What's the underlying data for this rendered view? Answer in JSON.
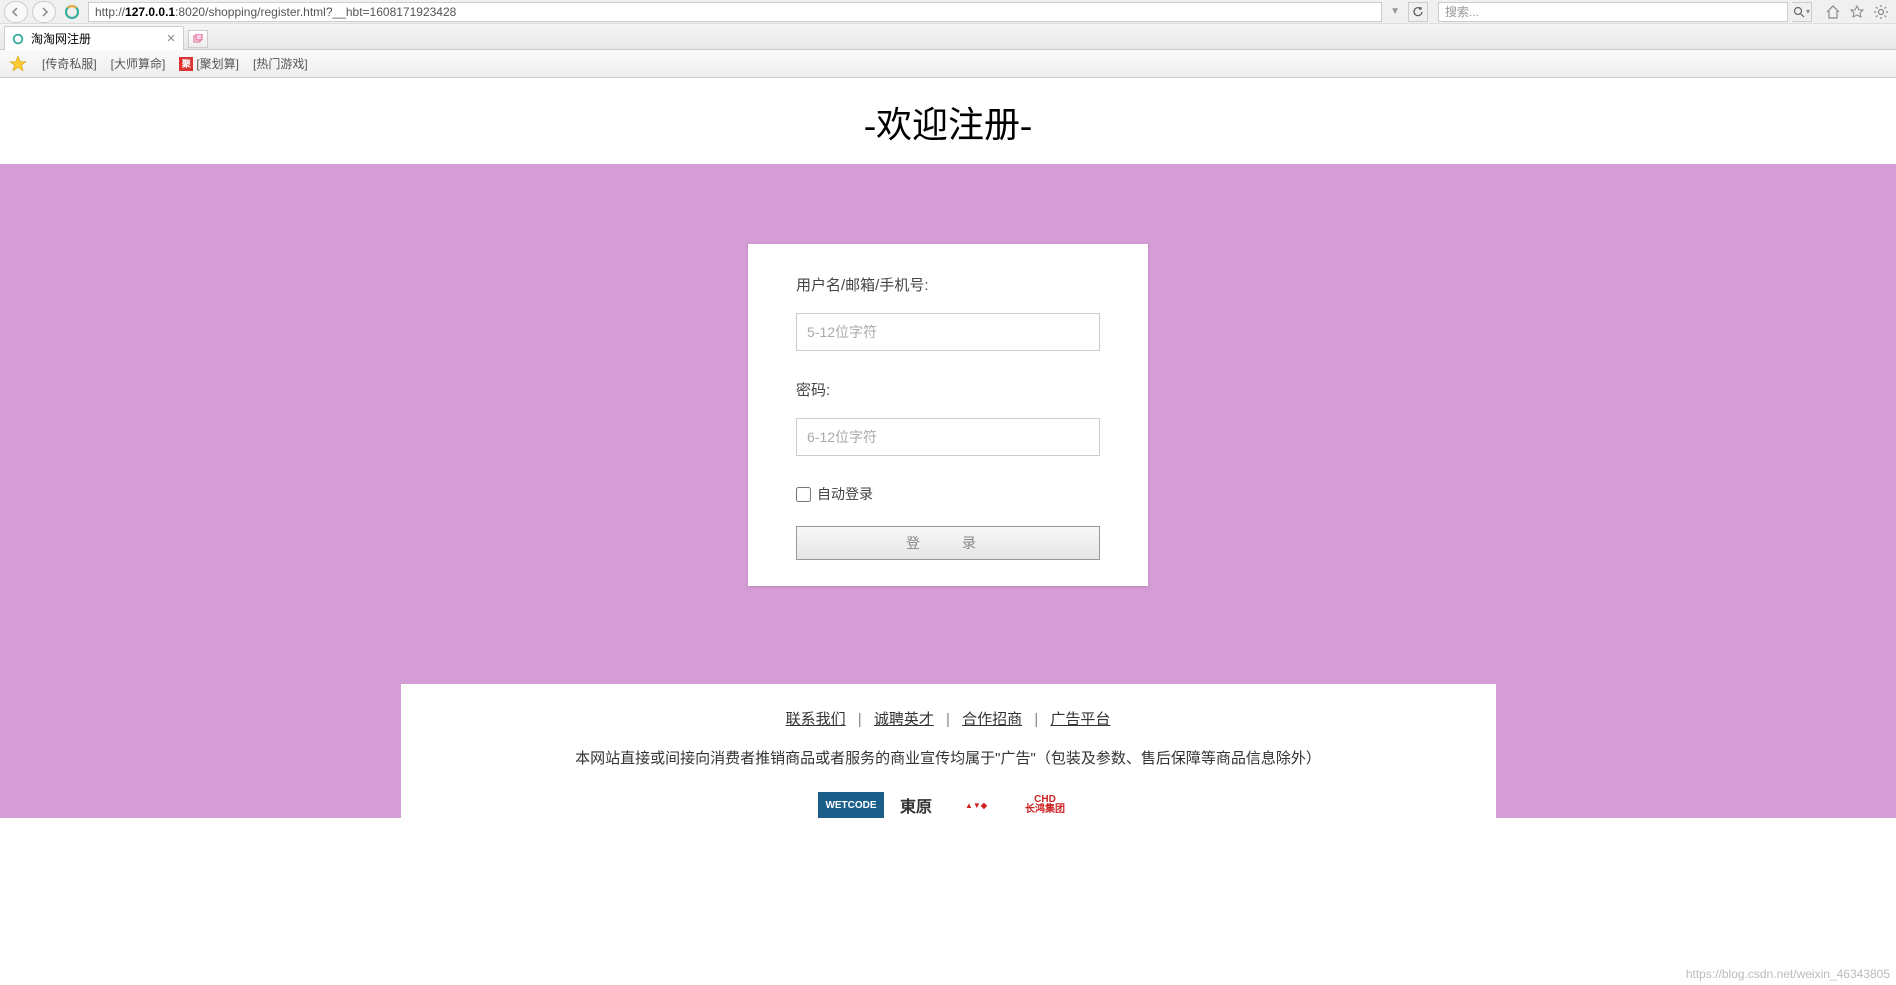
{
  "browser": {
    "url_prefix": "http://",
    "url_host": "127.0.0.1",
    "url_suffix": ":8020/shopping/register.html?__hbt=1608171923428",
    "search_placeholder": "搜索..."
  },
  "tab": {
    "title": "淘淘网注册"
  },
  "bookmarks": {
    "items": [
      "[传奇私服]",
      "[大师算命]",
      "[聚划算]",
      "[热门游戏]"
    ],
    "badge": "聚"
  },
  "page": {
    "title": "-欢迎注册-"
  },
  "form": {
    "username_label": "用户名/邮箱/手机号:",
    "username_placeholder": "5-12位字符",
    "password_label": "密码:",
    "password_placeholder": "6-12位字符",
    "auto_login": "自动登录",
    "submit": "登　录"
  },
  "footer": {
    "links": [
      "联系我们",
      "诚聘英才",
      "合作招商",
      "广告平台"
    ],
    "note": "本网站直接或间接向消费者推销商品或者服务的商业宣传均属于\"广告\"（包装及参数、售后保障等商品信息除外）",
    "logos": {
      "wetcode": "WETCODE",
      "dongyuan": "東原",
      "changhong_top": "CHD",
      "changhong_bottom": "长鸿集团"
    }
  },
  "watermark": "https://blog.csdn.net/weixin_46343805"
}
